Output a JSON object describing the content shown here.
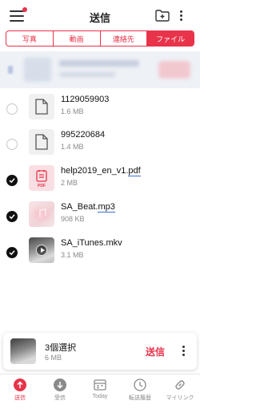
{
  "header": {
    "title": "送信",
    "menu_icon": "hamburger-menu-icon",
    "folder_icon": "folder-add-icon",
    "more_icon": "more-vertical-icon"
  },
  "tabs": [
    {
      "label": "写真",
      "active": false
    },
    {
      "label": "動画",
      "active": false
    },
    {
      "label": "連絡先",
      "active": false
    },
    {
      "label": "ファイル",
      "active": true
    }
  ],
  "files": [
    {
      "name": "1129059903",
      "size": "1.6 MB",
      "checked": false,
      "thumb": "document-icon"
    },
    {
      "name": "995220684",
      "size": "1.4 MB",
      "checked": false,
      "thumb": "document-icon"
    },
    {
      "name_base": "help2019_en_v1.",
      "name_ext": "pdf",
      "size": "2 MB",
      "checked": true,
      "thumb": "pdf-icon",
      "thumb_label": "PDF"
    },
    {
      "name_base": "SA_Beat.",
      "name_ext": "mp3",
      "size": "908 KB",
      "checked": true,
      "thumb": "music-note-icon"
    },
    {
      "name": "SA_iTunes.mkv",
      "size": "3.1 MB",
      "checked": true,
      "thumb": "video-play-icon"
    }
  ],
  "selection": {
    "count_label": "3個選択",
    "size": "6 MB",
    "send_label": "送信"
  },
  "nav": [
    {
      "label": "送信",
      "icon": "upload-icon",
      "active": true
    },
    {
      "label": "受信",
      "icon": "download-icon",
      "active": false
    },
    {
      "label": "Today",
      "icon": "today-icon",
      "active": false
    },
    {
      "label": "転送履歴",
      "icon": "history-clock-icon",
      "active": false
    },
    {
      "label": "マイリンク",
      "icon": "link-icon",
      "active": false
    }
  ],
  "colors": {
    "accent": "#e8334a",
    "link_underline": "#3b6fd8"
  }
}
